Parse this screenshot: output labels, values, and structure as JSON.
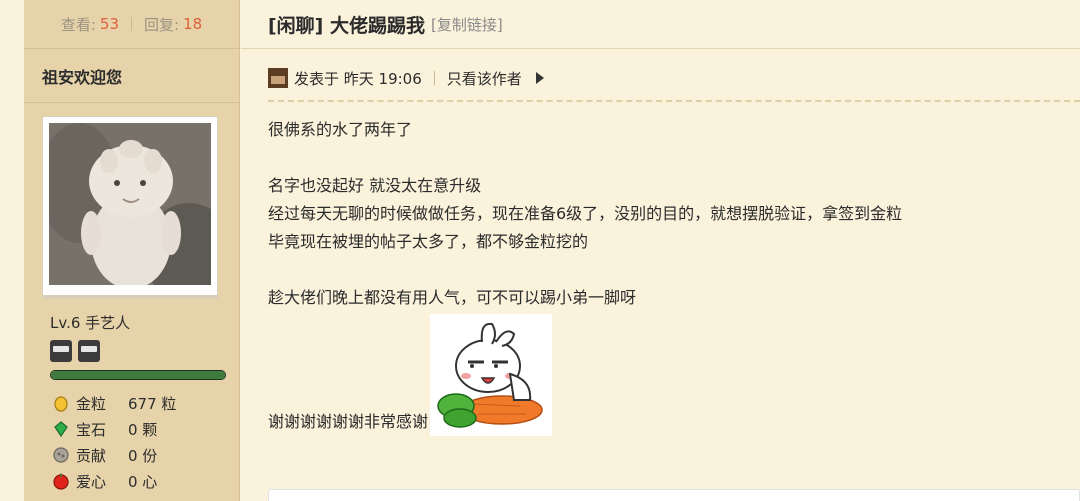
{
  "stats": {
    "views_label": "查看:",
    "views": "53",
    "replies_label": "回复:",
    "replies": "18"
  },
  "author": {
    "name": "祖安欢迎您",
    "level": "Lv.6 手艺人",
    "level_progress": 1.0,
    "attributes": [
      {
        "icon": "gold-grain-icon",
        "label": "金粒",
        "value": "677 粒"
      },
      {
        "icon": "gem-icon",
        "label": "宝石",
        "value": "0 颗"
      },
      {
        "icon": "contribution-icon",
        "label": "贡献",
        "value": "0 份"
      },
      {
        "icon": "heart-apple-icon",
        "label": "爱心",
        "value": "0 心"
      }
    ]
  },
  "thread": {
    "title": "[闲聊] 大佬踢踢我",
    "copy_link": "[复制链接]"
  },
  "post": {
    "posted_at": "发表于 昨天 19:06",
    "author_only": "只看该作者",
    "lines": [
      "很佛系的水了两年了",
      "",
      "名字也没起好 就没太在意升级",
      "经过每天无聊的时候做做任务，现在准备6级了，没别的目的，就想摆脱验证，拿签到金粒",
      "毕竟现在被埋的帖子太多了，都不够金粒挖的",
      "",
      "趁大佬们晚上都没有用人气，可不可以踢小弟一脚呀"
    ],
    "thanks": "谢谢谢谢谢谢非常感谢"
  },
  "colors": {
    "sidebar_bg": "#e6d3a9",
    "page_bg": "#fbf2dc",
    "stat_number": "#e0603c"
  }
}
